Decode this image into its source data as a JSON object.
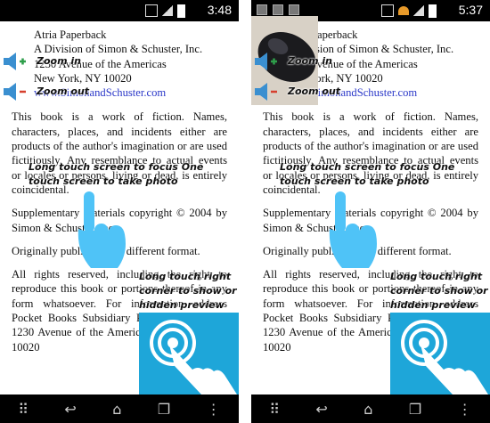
{
  "screens": [
    {
      "status": {
        "time": "3:48"
      },
      "publisher": [
        "Atria Paperback",
        "A Division of Simon & Schuster, Inc.",
        "1230 Avenue of the Americas",
        "New York, NY 10020",
        "www.SimonandSchuster.com"
      ],
      "paragraphs": [
        "This book is a work of fiction. Names, characters, places, and incidents either are products of the author's imagination or are used fictitiously. Any resemblance to actual events or locales or persons, living or dead, is entirely coincidental.",
        "Supplementary materials copyright © 2004 by Simon & Schuster, Inc.",
        "Originally published in a different format.",
        "All rights reserved, including the right to reproduce this book or portions thereof in any form whatsoever. For information address Pocket Books Subsidiary Rights Department, 1230 Avenue of the Americas, New York, NY 10020"
      ],
      "overlay": {
        "zoom_in": "Zoom in",
        "zoom_out": "Zoom out",
        "focus_hint_line1": "Long touch screen to focus One",
        "focus_hint_line2": "touch screen to take photo",
        "preview_hint_line1": "Long touch right",
        "preview_hint_line2": "corner to show or",
        "preview_hint_line3": "hidden preview"
      }
    },
    {
      "status": {
        "time": "5:37"
      },
      "publisher": [
        "Atria Paperback",
        "A Division of Simon & Schuster, Inc.",
        "1230 Avenue of the Americas",
        "New York, NY 10020",
        "www.SimonandSchuster.com"
      ],
      "paragraphs": [
        "This book is a work of fiction. Names, characters, places, and incidents either are products of the author's imagination or are used fictitiously. Any resemblance to actual events or locales or persons, living or dead, is entirely coincidental.",
        "Supplementary materials copyright © 2004 by Simon & Schuster, Inc.",
        "Originally published in a different format.",
        "All rights reserved, including the right to reproduce this book or portions thereof in any form whatsoever. For information address Pocket Books Subsidiary Rights Department, 1230 Avenue of the Americas, New York, NY 10020"
      ],
      "overlay": {
        "zoom_in": "Zoom in",
        "zoom_out": "Zoom out",
        "focus_hint_line1": "Long touch screen to focus One",
        "focus_hint_line2": "touch screen to take photo",
        "preview_hint_line1": "Long touch right",
        "preview_hint_line2": "corner to show or",
        "preview_hint_line3": "hidden preview"
      }
    }
  ],
  "navbar": {
    "menu_icon": "grid-icon",
    "back_icon": "back-icon",
    "home_icon": "home-icon",
    "recents_icon": "recents-icon",
    "more_icon": "more-vert-icon"
  },
  "colors": {
    "accent": "#1ea6d9",
    "link": "#2a37c8",
    "finger": "#4fc3f7",
    "zoom_in": "#2e9e4a",
    "zoom_out": "#d6402e"
  }
}
